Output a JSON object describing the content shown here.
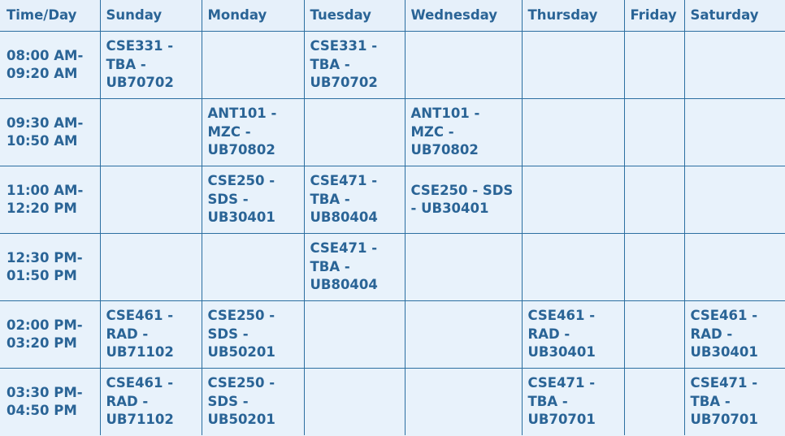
{
  "headers": [
    "Time/Day",
    "Sunday",
    "Monday",
    "Tuesday",
    "Wednesday",
    "Thursday",
    "Friday",
    "Saturday"
  ],
  "rows": [
    {
      "time": "08:00 AM-\n09:20 AM",
      "cells": [
        "CSE331 -\nTBA -\nUB70702",
        "",
        "CSE331 -\nTBA -\nUB70702",
        "",
        "",
        "",
        ""
      ]
    },
    {
      "time": "09:30 AM-\n10:50 AM",
      "cells": [
        "",
        "ANT101 -\nMZC -\nUB70802",
        "",
        "ANT101 -\nMZC -\nUB70802",
        "",
        "",
        ""
      ]
    },
    {
      "time": "11:00 AM-\n12:20 PM",
      "cells": [
        "",
        "CSE250 -\nSDS -\nUB30401",
        "CSE471 -\nTBA -\nUB80404",
        "CSE250 - SDS\n- UB30401",
        "",
        "",
        ""
      ]
    },
    {
      "time": "12:30 PM-\n01:50 PM",
      "cells": [
        "",
        "",
        "CSE471 -\nTBA -\nUB80404",
        "",
        "",
        "",
        ""
      ]
    },
    {
      "time": "02:00 PM-\n03:20 PM",
      "cells": [
        "CSE461 -\nRAD -\nUB71102",
        "CSE250 -\nSDS -\nUB50201",
        "",
        "",
        "CSE461 -\nRAD -\nUB30401",
        "",
        "CSE461 -\nRAD -\nUB30401"
      ]
    },
    {
      "time": "03:30 PM-\n04:50 PM",
      "cells": [
        "CSE461 -\nRAD -\nUB71102",
        "CSE250 -\nSDS -\nUB50201",
        "",
        "",
        "CSE471 -\nTBA -\nUB70701",
        "",
        "CSE471 -\nTBA -\nUB70701"
      ]
    }
  ]
}
